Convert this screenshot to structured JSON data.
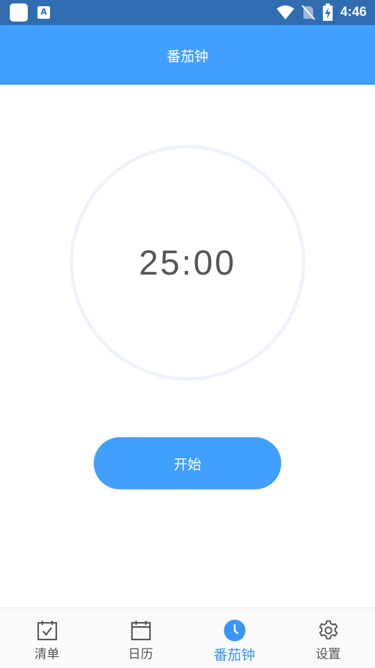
{
  "status_bar": {
    "time": "4:46",
    "icons": [
      "app-square-icon",
      "keyboard-a-icon",
      "wifi-icon",
      "no-sim-icon",
      "battery-charging-icon"
    ]
  },
  "header": {
    "title": "番茄钟"
  },
  "timer": {
    "display": "25:00",
    "progress": 0
  },
  "start_button": {
    "label": "开始"
  },
  "bottom_nav": {
    "items": [
      {
        "label": "清单",
        "icon": "checklist-calendar-icon",
        "active": false
      },
      {
        "label": "日历",
        "icon": "calendar-icon",
        "active": false
      },
      {
        "label": "番茄钟",
        "icon": "clock-icon",
        "active": true
      },
      {
        "label": "设置",
        "icon": "gear-icon",
        "active": false
      }
    ]
  },
  "colors": {
    "status_bar": "#2f6db0",
    "accent": "#419ffd",
    "ring": "#eef3fb",
    "timer_text": "#555459",
    "nav_active": "#3a96f5",
    "nav_inactive": "#555555"
  }
}
